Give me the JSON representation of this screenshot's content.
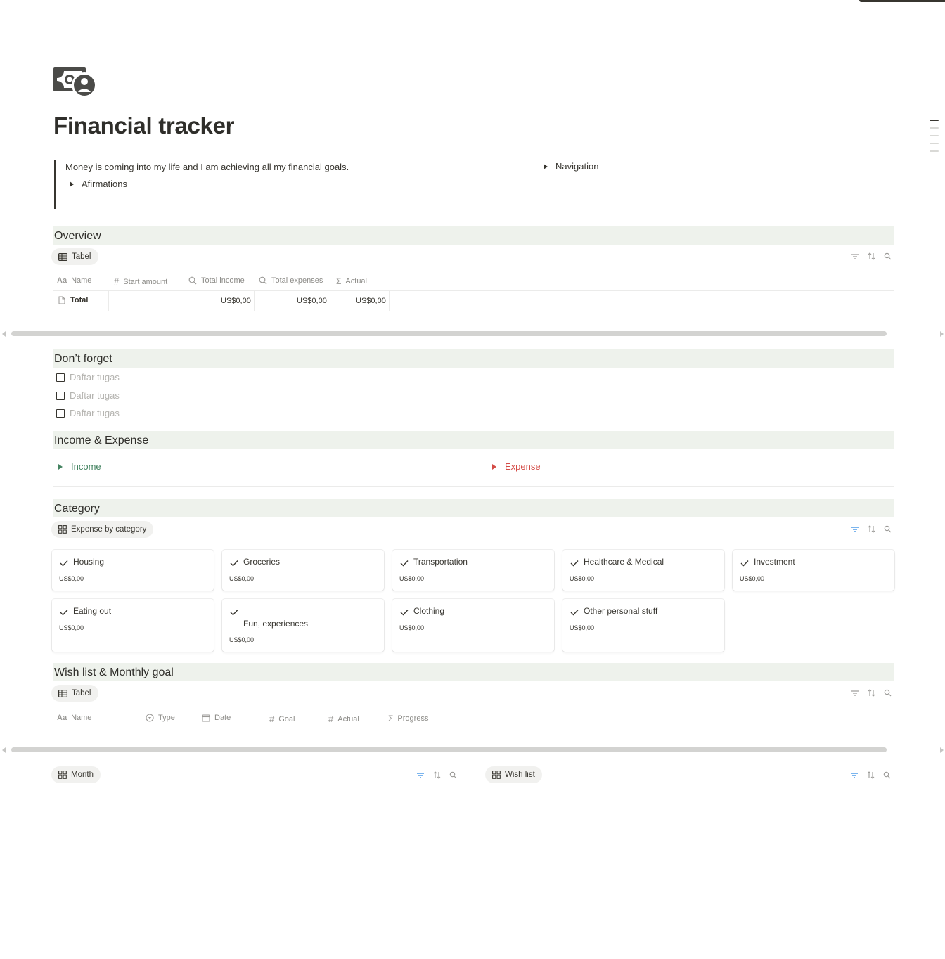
{
  "page": {
    "title": "Financial tracker",
    "icon": "money-bill-user-icon",
    "quote": "Money is coming into my life and I am achieving all my financial goals.",
    "affirmations_label": "Afirmations",
    "navigation_label": "Navigation"
  },
  "overview": {
    "header": "Overview",
    "view_tab": "Tabel",
    "columns": [
      "Name",
      "Start amount",
      "Total income",
      "Total expenses",
      "Actual"
    ],
    "row": {
      "name": "Total",
      "start_amount": "",
      "total_income": "US$0,00",
      "total_expenses": "US$0,00",
      "actual": "US$0,00"
    }
  },
  "dont_forget": {
    "header": "Don’t forget",
    "items": [
      "Daftar tugas",
      "Daftar tugas",
      "Daftar tugas"
    ]
  },
  "income_expense": {
    "header": "Income & Expense",
    "income_label": "Income",
    "expense_label": "Expense",
    "income_color": "#448361",
    "expense_color": "#d44c47"
  },
  "category": {
    "header": "Category",
    "view_tab": "Expense by category",
    "cards": [
      {
        "name": "Housing",
        "value": "US$0,00"
      },
      {
        "name": "Groceries",
        "value": "US$0,00"
      },
      {
        "name": "Transportation",
        "value": "US$0,00"
      },
      {
        "name": "Healthcare & Medical",
        "value": "US$0,00"
      },
      {
        "name": "Investment",
        "value": "US$0,00"
      },
      {
        "name": "Eating out",
        "value": "US$0,00"
      },
      {
        "name": "Fun, experiences",
        "value": "US$0,00"
      },
      {
        "name": "Clothing",
        "value": "US$0,00"
      },
      {
        "name": "Other personal stuff",
        "value": "US$0,00"
      }
    ]
  },
  "wishlist": {
    "header": "Wish list & Monthly goal",
    "view_tab": "Tabel",
    "columns": [
      "Name",
      "Type",
      "Date",
      "Goal",
      "Actual",
      "Progress"
    ],
    "month_tab": "Month",
    "wish_tab": "Wish list"
  },
  "colors": {
    "section_bg": "#eef2ec",
    "filter_active": "#2383e2",
    "text": "#37352f"
  }
}
